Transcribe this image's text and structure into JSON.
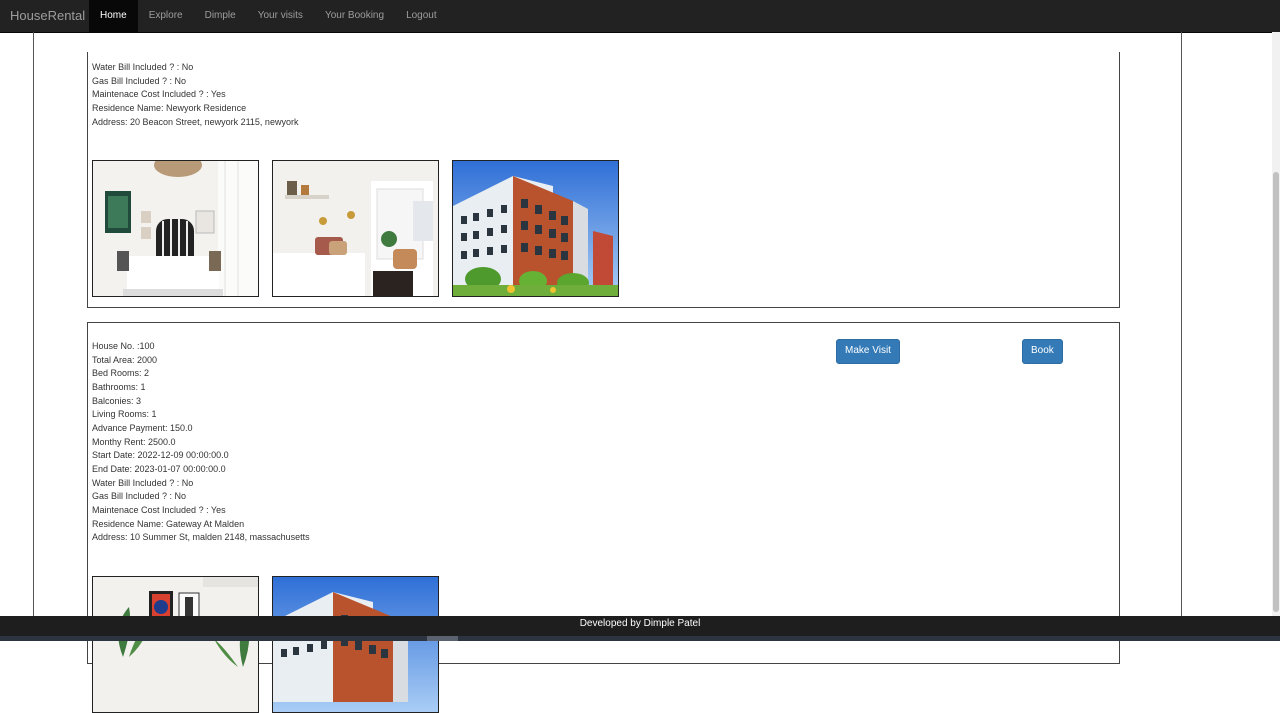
{
  "navbar": {
    "brand": "HouseRental",
    "items": [
      {
        "label": "Home",
        "active": true
      },
      {
        "label": "Explore",
        "active": false
      },
      {
        "label": "Dimple",
        "active": false
      },
      {
        "label": "Your visits",
        "active": false
      },
      {
        "label": "Your Booking",
        "active": false
      },
      {
        "label": "Logout",
        "active": false
      }
    ]
  },
  "listing1": {
    "details": [
      "Water Bill Included ? : No",
      "Gas Bill Included ? : No",
      "Maintenace Cost Included ? : Yes",
      "Residence Name: Newyork Residence",
      "Address: 20 Beacon Street, newyork 2115, newyork"
    ],
    "images": [
      "bedroom-photo",
      "bedroom-photo",
      "apartment-building-photo"
    ]
  },
  "listing2": {
    "details": [
      "House No. :100",
      "Total Area: 2000",
      "Bed Rooms: 2",
      "Bathrooms: 1",
      "Balconies: 3",
      "Living Rooms: 1",
      "Advance Payment: 150.0",
      "Monthy Rent: 2500.0",
      "Start Date: 2022-12-09 00:00:00.0",
      "End Date: 2023-01-07 00:00:00.0",
      "Water Bill Included ? : No",
      "Gas Bill Included ? : No",
      "Maintenace Cost Included ? : Yes",
      "Residence Name: Gateway At Malden",
      "Address: 10 Summer St, malden 2148, massachusetts"
    ],
    "make_visit_label": "Make Visit",
    "book_label": "Book",
    "images": [
      "living-room-photo",
      "apartment-building-photo"
    ]
  },
  "footer": {
    "text": "Developed by Dimple Patel"
  },
  "colors": {
    "navbar_bg": "#222222",
    "active_tab_bg": "#080808",
    "button_primary": "#337ab7"
  }
}
